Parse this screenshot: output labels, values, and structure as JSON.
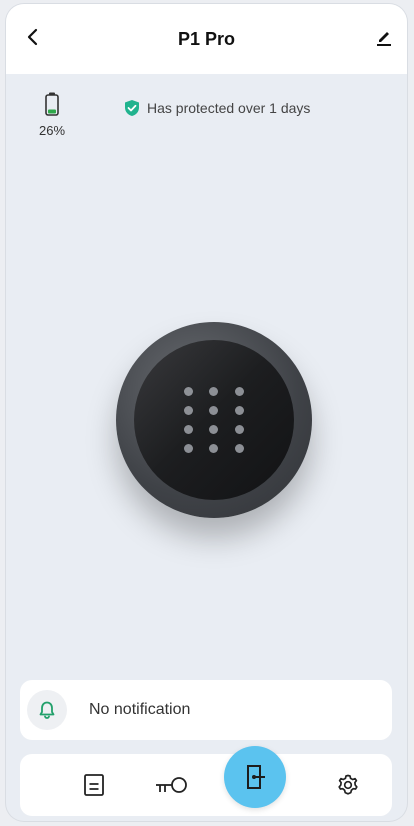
{
  "header": {
    "title": "P1 Pro"
  },
  "battery": {
    "percent": "26%",
    "level": 0.26
  },
  "status": {
    "text": "Has protected over 1 days"
  },
  "notification": {
    "text": "No notification"
  },
  "tabs": [
    {
      "name": "logs",
      "icon": "document-icon"
    },
    {
      "name": "keys",
      "icon": "key-icon"
    },
    {
      "name": "unlock",
      "icon": "door-icon",
      "active": true
    },
    {
      "name": "settings",
      "icon": "gear-icon"
    }
  ],
  "colors": {
    "accent": "#5bc3ef",
    "battery": "#2ea84a",
    "shield": "#20b38e",
    "bell": "#22a06b"
  }
}
